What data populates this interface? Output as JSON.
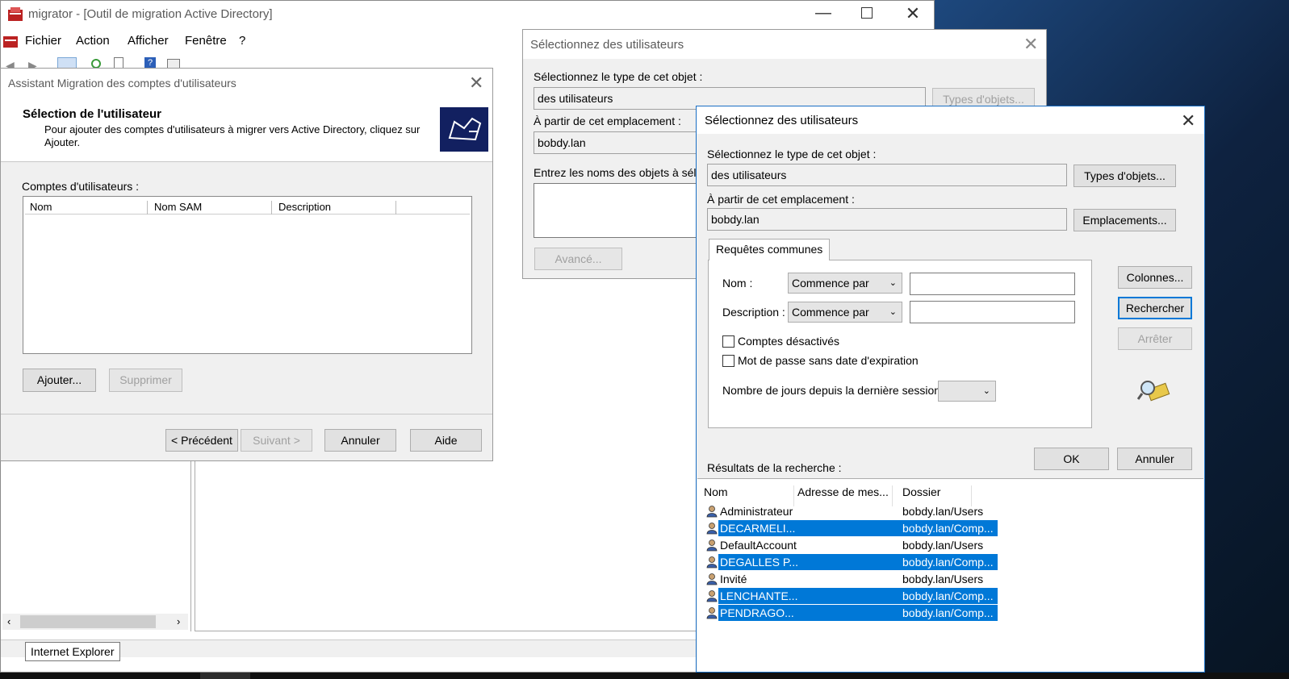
{
  "main_window": {
    "title": "migrator - [Outil de migration Active Directory]",
    "menu": [
      "Fichier",
      "Action",
      "Afficher",
      "Fenêtre",
      "?"
    ]
  },
  "wizard": {
    "title": "Assistant Migration des comptes d'utilisateurs",
    "heading": "Sélection de l'utilisateur",
    "description_line1": "Pour ajouter des comptes d'utilisateurs à migrer vers Active Directory, cliquez sur",
    "description_line2": "Ajouter.",
    "list_label": "Comptes d'utilisateurs :",
    "columns": [
      "Nom",
      "Nom SAM",
      "Description"
    ],
    "add_button": "Ajouter...",
    "remove_button": "Supprimer",
    "back_button": "< Précédent",
    "next_button": "Suivant >",
    "cancel_button": "Annuler",
    "help_button": "Aide"
  },
  "tooltip": "Internet Explorer",
  "select_users_bg": {
    "title": "Sélectionnez des utilisateurs",
    "object_type_label": "Sélectionnez le type de cet objet :",
    "object_type_value": "des utilisateurs",
    "object_types_button": "Types d'objets...",
    "location_label": "À partir de cet emplacement :",
    "location_value": "bobdy.lan",
    "names_label": "Entrez les noms des objets à sélect",
    "advanced_button": "Avancé..."
  },
  "select_users": {
    "title": "Sélectionnez des utilisateurs",
    "object_type_label": "Sélectionnez le type de cet objet :",
    "object_type_value": "des utilisateurs",
    "object_types_button": "Types d'objets...",
    "location_label": "À partir de cet emplacement :",
    "location_value": "bobdy.lan",
    "locations_button": "Emplacements...",
    "tab_label": "Requêtes communes",
    "name_label": "Nom :",
    "name_mode": "Commence par",
    "desc_label": "Description :",
    "desc_mode": "Commence par",
    "disabled_accounts": "Comptes désactivés",
    "no_expire_password": "Mot de passe sans date d'expiration",
    "days_label": "Nombre de jours depuis la dernière session :",
    "columns_button": "Colonnes...",
    "search_button": "Rechercher",
    "stop_button": "Arrêter",
    "ok_button": "OK",
    "cancel_button": "Annuler",
    "results_label": "Résultats de la recherche :",
    "results_columns": [
      "Nom",
      "Adresse de mes...",
      "Dossier"
    ],
    "results": [
      {
        "name": "Administrateur",
        "folder": "bobdy.lan/Users",
        "selected": false
      },
      {
        "name": "DECARMELI...",
        "folder": "bobdy.lan/Comp...",
        "selected": true
      },
      {
        "name": "DefaultAccount",
        "folder": "bobdy.lan/Users",
        "selected": false
      },
      {
        "name": "DEGALLES P...",
        "folder": "bobdy.lan/Comp...",
        "selected": true
      },
      {
        "name": "Invité",
        "folder": "bobdy.lan/Users",
        "selected": false
      },
      {
        "name": "LENCHANTE...",
        "folder": "bobdy.lan/Comp...",
        "selected": true
      },
      {
        "name": "PENDRAGO...",
        "folder": "bobdy.lan/Comp...",
        "selected": true
      }
    ],
    "selection_color": "#0078d7"
  }
}
